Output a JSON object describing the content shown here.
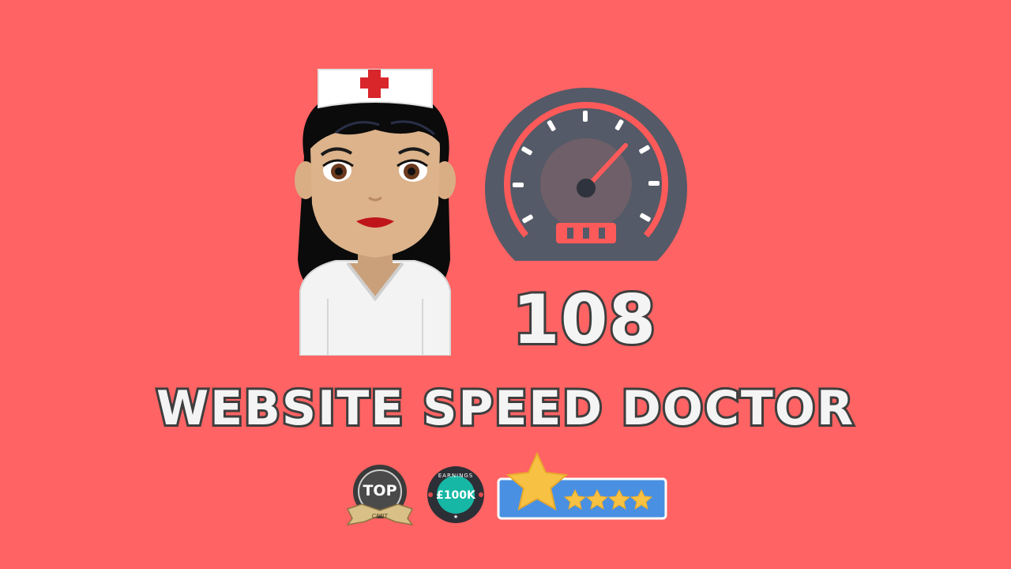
{
  "score": {
    "value": "108"
  },
  "title": {
    "text": "WEBSITE SPEED DOCTOR"
  },
  "badges": {
    "top": {
      "line1": "TOP",
      "line2": "CERT"
    },
    "earnings": {
      "label": "EARNINGS",
      "amount": "£100K"
    },
    "rating": {
      "stars": 5
    }
  },
  "colors": {
    "background": "#ff6363",
    "gauge_face": "#545a67",
    "gauge_accent": "#ff5a5a",
    "text_fill": "#f4f4f4",
    "text_outline": "#3e3e3e"
  },
  "icons": {
    "nurse": "nurse-avatar-icon",
    "gauge": "speedometer-icon",
    "top_badge": "top-cert-badge-icon",
    "earnings_badge": "earnings-badge-icon",
    "rating_badge": "star-rating-badge-icon"
  }
}
